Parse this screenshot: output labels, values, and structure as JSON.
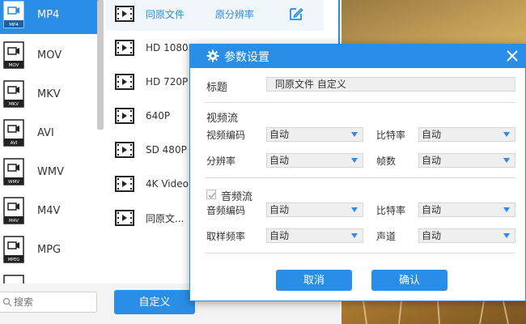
{
  "formats": [
    {
      "label": "MP4",
      "badge": "MP4",
      "active": true
    },
    {
      "label": "MOV",
      "badge": "MOV",
      "active": false
    },
    {
      "label": "MKV",
      "badge": "MKV",
      "active": false
    },
    {
      "label": "AVI",
      "badge": "AVI",
      "active": false
    },
    {
      "label": "WMV",
      "badge": "WMV",
      "active": false
    },
    {
      "label": "M4V",
      "badge": "M4V",
      "active": false
    },
    {
      "label": "MPG",
      "badge": "MPEG",
      "active": false
    }
  ],
  "presets": [
    {
      "label": "同原文件",
      "resolution": "原分辨率"
    },
    {
      "label": "HD 1080P",
      "resolution": ""
    },
    {
      "label": "HD 720P",
      "resolution": ""
    },
    {
      "label": "640P",
      "resolution": ""
    },
    {
      "label": "SD 480P",
      "resolution": ""
    },
    {
      "label": "4K Video",
      "resolution": ""
    },
    {
      "label": "同原文...",
      "resolution": ""
    }
  ],
  "bottom": {
    "search_placeholder": "搜索",
    "custom_label": "自定义"
  },
  "dialog": {
    "title": "参数设置",
    "title_label": "标题",
    "title_value": "同原文件 自定义",
    "video": {
      "section": "视频流",
      "codec_label": "视频编码",
      "codec_value": "自动",
      "bitrate_label": "比特率",
      "bitrate_value": "自动",
      "resolution_label": "分辨率",
      "resolution_value": "自动",
      "framerate_label": "帧数",
      "framerate_value": "自动"
    },
    "audio": {
      "section": "音频流",
      "checked": true,
      "codec_label": "音频编码",
      "codec_value": "自动",
      "bitrate_label": "比特率",
      "bitrate_value": "自动",
      "samplerate_label": "取样频率",
      "samplerate_value": "自动",
      "channel_label": "声道",
      "channel_value": "自动"
    },
    "cancel_label": "取消",
    "confirm_label": "确认"
  },
  "colors": {
    "accent": "#2a8ee6"
  }
}
